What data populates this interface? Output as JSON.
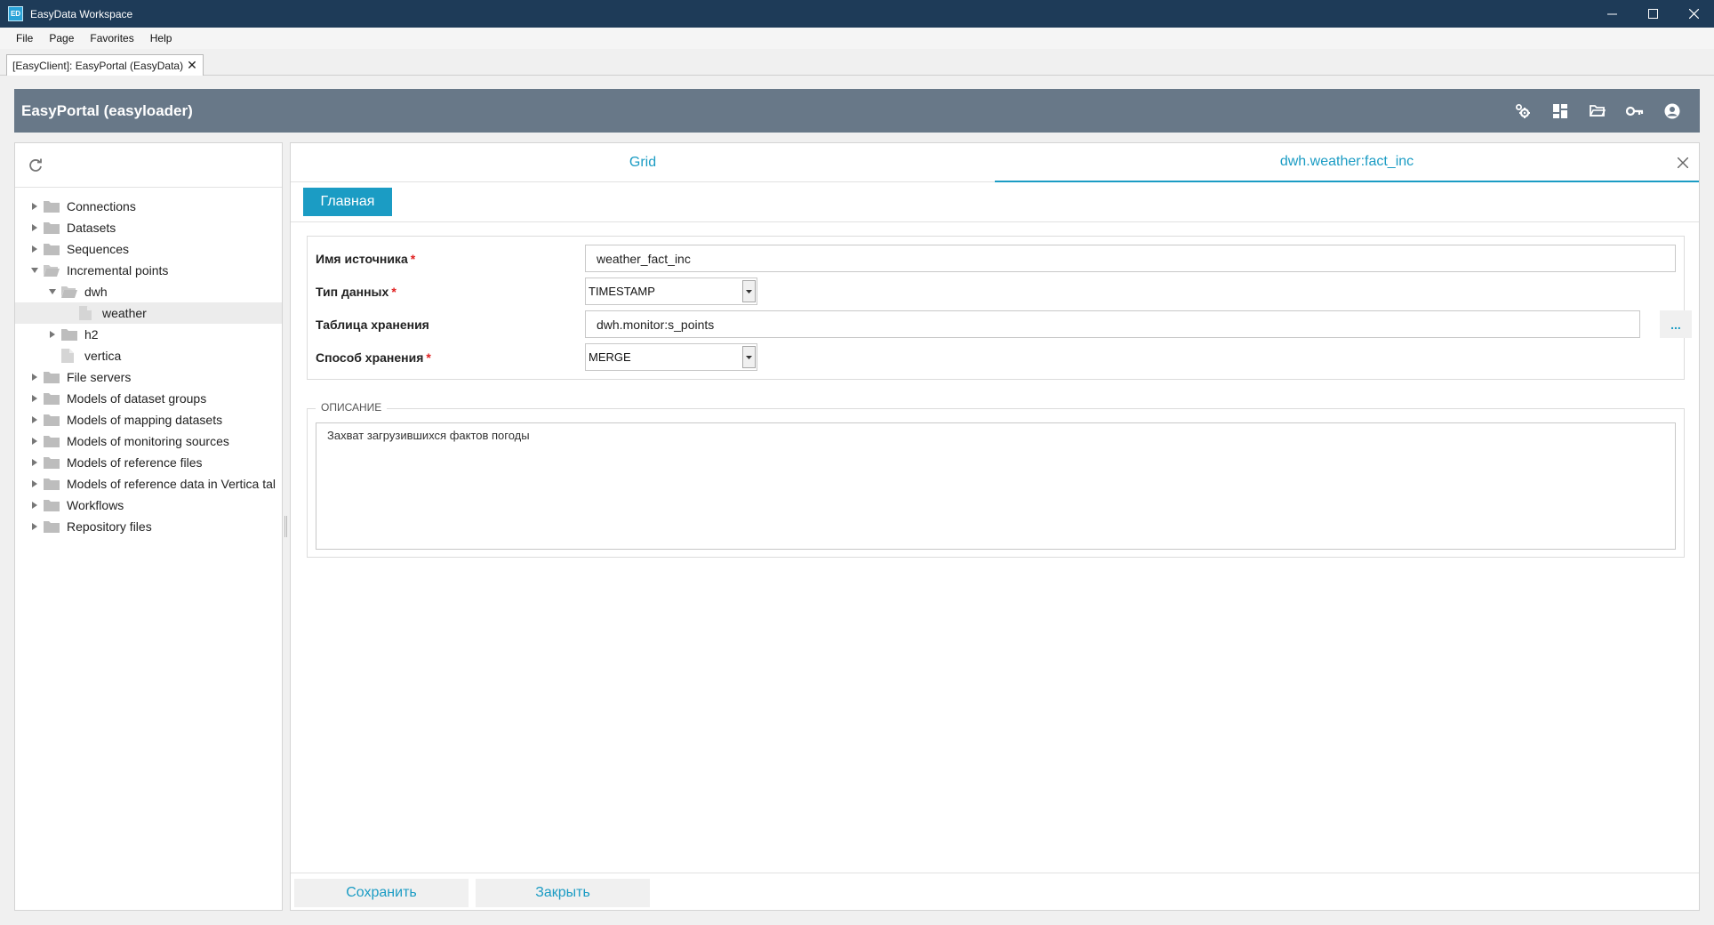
{
  "window": {
    "title": "EasyData Workspace",
    "icon_text": "ED",
    "controls": [
      "minimize-icon",
      "maximize-icon",
      "close-icon"
    ]
  },
  "menu": [
    "File",
    "Page",
    "Favorites",
    "Help"
  ],
  "doc_tab": {
    "label": "[EasyClient]: EasyPortal (EasyData)",
    "close": "✕"
  },
  "header": {
    "title": "EasyPortal (easyloader)",
    "icons": [
      "settings-gears-icon",
      "dashboard-icon",
      "folder-open-icon",
      "key-icon",
      "account-icon"
    ]
  },
  "tree": {
    "refresh_icon": "refresh-icon",
    "items": [
      {
        "label": "Connections",
        "level": 0,
        "expand": "collapsed",
        "icon": "folder"
      },
      {
        "label": "Datasets",
        "level": 0,
        "expand": "collapsed",
        "icon": "folder"
      },
      {
        "label": "Sequences",
        "level": 0,
        "expand": "collapsed",
        "icon": "folder"
      },
      {
        "label": "Incremental points",
        "level": 0,
        "expand": "expanded",
        "icon": "folder-open"
      },
      {
        "label": "dwh",
        "level": 1,
        "expand": "expanded",
        "icon": "folder-open"
      },
      {
        "label": "weather",
        "level": 2,
        "expand": "none",
        "icon": "file",
        "selected": true
      },
      {
        "label": "h2",
        "level": 1,
        "expand": "collapsed",
        "icon": "folder"
      },
      {
        "label": "vertica",
        "level": 1,
        "expand": "none",
        "icon": "file"
      },
      {
        "label": "File servers",
        "level": 0,
        "expand": "collapsed",
        "icon": "folder"
      },
      {
        "label": "Models of dataset groups",
        "level": 0,
        "expand": "collapsed",
        "icon": "folder"
      },
      {
        "label": "Models of mapping datasets",
        "level": 0,
        "expand": "collapsed",
        "icon": "folder"
      },
      {
        "label": "Models of monitoring sources",
        "level": 0,
        "expand": "collapsed",
        "icon": "folder"
      },
      {
        "label": "Models of reference files",
        "level": 0,
        "expand": "collapsed",
        "icon": "folder"
      },
      {
        "label": "Models of reference data in Vertica tal",
        "level": 0,
        "expand": "collapsed",
        "icon": "folder"
      },
      {
        "label": "Workflows",
        "level": 0,
        "expand": "collapsed",
        "icon": "folder"
      },
      {
        "label": "Repository files",
        "level": 0,
        "expand": "collapsed",
        "icon": "folder"
      }
    ]
  },
  "tabs": {
    "grid": "Grid",
    "active": "dwh.weather:fact_inc"
  },
  "main_button": "Главная",
  "form": {
    "source_name": {
      "label": "Имя источника",
      "required": "*",
      "value": "weather_fact_inc"
    },
    "data_type": {
      "label": "Тип данных",
      "required": "*",
      "value": "TIMESTAMP"
    },
    "storage_table": {
      "label": "Таблица хранения",
      "value": "dwh.monitor:s_points",
      "button": "..."
    },
    "storage_method": {
      "label": "Способ хранения",
      "required": "*",
      "value": "MERGE"
    }
  },
  "description": {
    "legend": "ОПИСАНИЕ",
    "text": "Захват загрузившихся фактов погоды"
  },
  "footer": {
    "save": "Сохранить",
    "close": "Закрыть"
  },
  "colors": {
    "accent": "#1b9cc4",
    "titlebar": "#1e3b58",
    "header": "#687888",
    "required": "#e02020"
  }
}
